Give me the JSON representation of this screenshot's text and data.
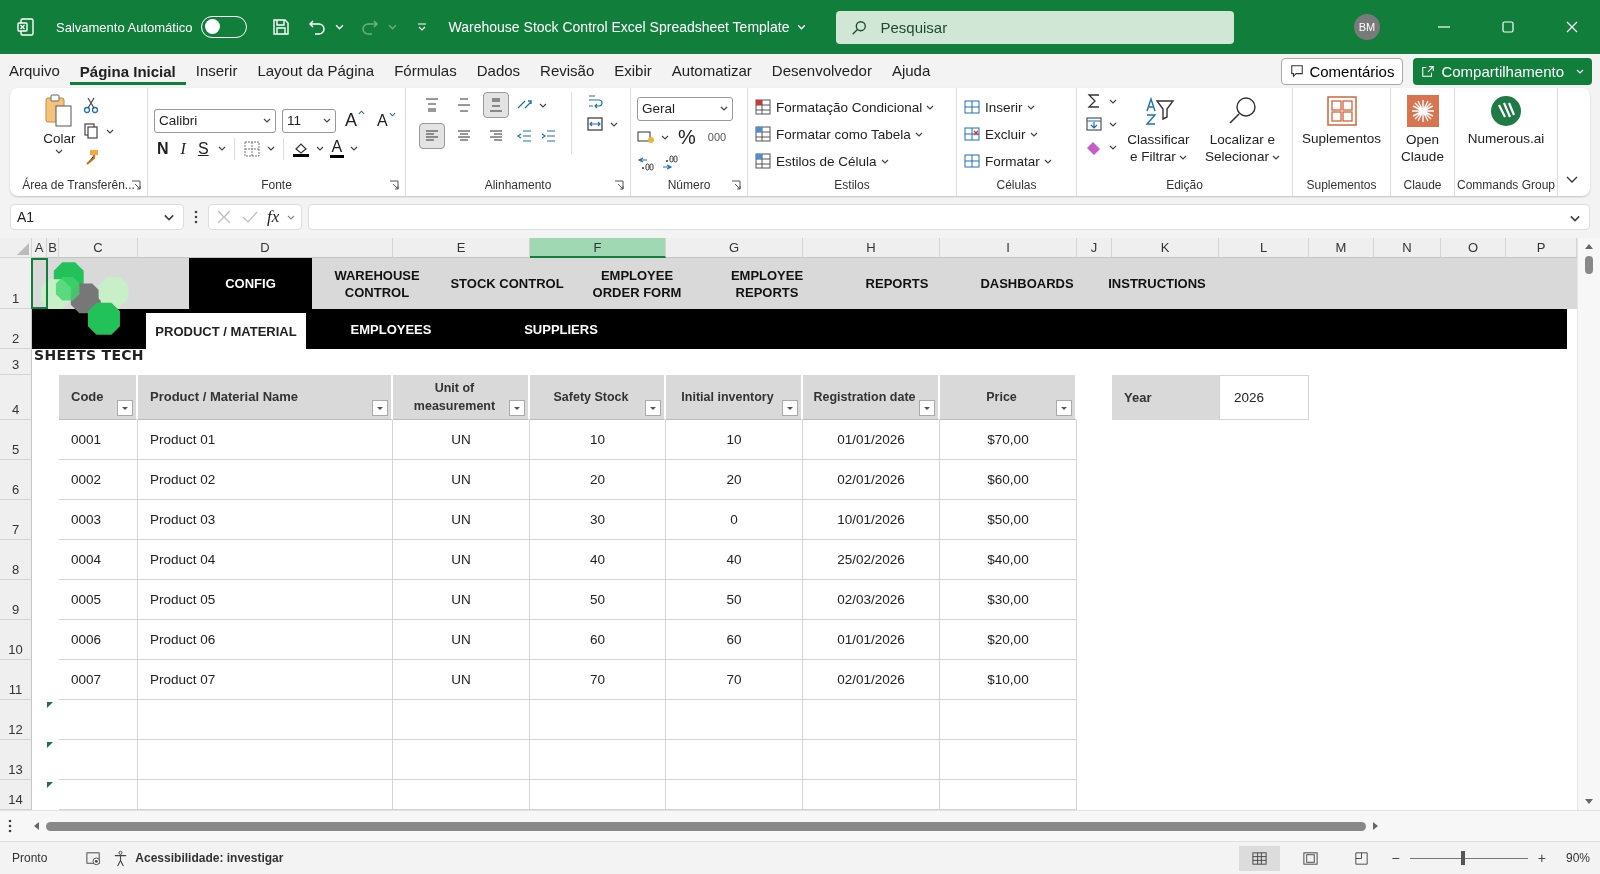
{
  "title_bar": {
    "autosave_label": "Salvamento Automático",
    "autosave_on": false,
    "document_title": "Warehouse Stock Control Excel Spreadsheet Template",
    "search_placeholder": "Pesquisar",
    "user_initials": "BM"
  },
  "menu_tabs": [
    {
      "label": "Arquivo",
      "selected": false
    },
    {
      "label": "Página Inicial",
      "selected": true
    },
    {
      "label": "Inserir",
      "selected": false
    },
    {
      "label": "Layout da Página",
      "selected": false
    },
    {
      "label": "Fórmulas",
      "selected": false
    },
    {
      "label": "Dados",
      "selected": false
    },
    {
      "label": "Revisão",
      "selected": false
    },
    {
      "label": "Exibir",
      "selected": false
    },
    {
      "label": "Automatizar",
      "selected": false
    },
    {
      "label": "Desenvolvedor",
      "selected": false
    },
    {
      "label": "Ajuda",
      "selected": false
    }
  ],
  "comments_button": "Comentários",
  "share_button": "Compartilhamento",
  "ribbon": {
    "clipboard": {
      "label": "Área de Transferên...",
      "paste": "Colar"
    },
    "font": {
      "label": "Fonte",
      "font_name": "Calibri",
      "font_size": "11",
      "grow": "A",
      "shrink": "A",
      "bold": "N",
      "italic": "I",
      "underline": "S",
      "font_color": "A"
    },
    "alignment": {
      "label": "Alinhamento",
      "vertical_buttons": [
        {
          "selected": false
        },
        {
          "selected": false
        },
        {
          "selected": true
        }
      ],
      "horizontal_buttons": [
        {
          "selected": true
        },
        {
          "selected": false
        },
        {
          "selected": false
        }
      ]
    },
    "number": {
      "label": "Número",
      "format": "Geral",
      "percent": "%",
      "thousands": "000"
    },
    "styles": {
      "label": "Estilos",
      "items": [
        "Formatação Condicional",
        "Formatar como Tabela",
        "Estilos de Célula"
      ]
    },
    "cells": {
      "label": "Células",
      "items": [
        "Inserir",
        "Excluir",
        "Formatar"
      ]
    },
    "editing": {
      "label": "Edição",
      "sort": "Classificar e Filtrar",
      "find": "Localizar e Selecionar"
    },
    "addins": {
      "label": "Suplementos",
      "button": "Suplementos"
    },
    "claude": {
      "label": "Claude",
      "button": "Open Claude"
    },
    "commands": {
      "label": "Commands Group",
      "button": "Numerous.ai"
    }
  },
  "formula_bar": {
    "name_box": "A1",
    "fx": "fx"
  },
  "columns": [
    {
      "label": "A",
      "selected": false
    },
    {
      "label": "B",
      "selected": false
    },
    {
      "label": "C",
      "selected": false
    },
    {
      "label": "D",
      "selected": false
    },
    {
      "label": "E",
      "selected": false
    },
    {
      "label": "F",
      "selected": true
    },
    {
      "label": "G",
      "selected": false
    },
    {
      "label": "H",
      "selected": false
    },
    {
      "label": "I",
      "selected": false
    },
    {
      "label": "J",
      "selected": false
    },
    {
      "label": "K",
      "selected": false
    },
    {
      "label": "L",
      "selected": false
    },
    {
      "label": "M",
      "selected": false
    },
    {
      "label": "N",
      "selected": false
    },
    {
      "label": "O",
      "selected": false
    },
    {
      "label": "P",
      "selected": false
    }
  ],
  "row_numbers": [
    "1",
    "2",
    "3",
    "4",
    "5",
    "6",
    "7",
    "8",
    "9",
    "10",
    "11",
    "12",
    "13",
    "14"
  ],
  "sheet": {
    "logo_text": "SHEETS TECH",
    "nav": [
      {
        "label": "CONFIG",
        "selected": true
      },
      {
        "label": "WAREHOUSE CONTROL",
        "selected": false
      },
      {
        "label": "STOCK CONTROL",
        "selected": false
      },
      {
        "label": "EMPLOYEE ORDER FORM",
        "selected": false
      },
      {
        "label": "EMPLOYEE REPORTS",
        "selected": false
      },
      {
        "label": "REPORTS",
        "selected": false
      },
      {
        "label": "DASHBOARDS",
        "selected": false
      },
      {
        "label": "INSTRUCTIONS",
        "selected": false
      }
    ],
    "subnav": [
      {
        "label": "PRODUCT / MATERIAL",
        "selected": true
      },
      {
        "label": "EMPLOYEES",
        "selected": false
      },
      {
        "label": "SUPPLIERS",
        "selected": false
      }
    ],
    "table": {
      "columns": [
        "Code",
        "Product / Material Name",
        "Unit of measurement",
        "Safety Stock",
        "Initial inventory",
        "Registration date",
        "Price"
      ],
      "rows": [
        [
          "0001",
          "Product 01",
          "UN",
          "10",
          "10",
          "01/01/2026",
          "$70,00"
        ],
        [
          "0002",
          "Product 02",
          "UN",
          "20",
          "20",
          "02/01/2026",
          "$60,00"
        ],
        [
          "0003",
          "Product 03",
          "UN",
          "30",
          "0",
          "10/01/2026",
          "$50,00"
        ],
        [
          "0004",
          "Product 04",
          "UN",
          "40",
          "40",
          "25/02/2026",
          "$40,00"
        ],
        [
          "0005",
          "Product 05",
          "UN",
          "50",
          "50",
          "02/03/2026",
          "$30,00"
        ],
        [
          "0006",
          "Product 06",
          "UN",
          "60",
          "60",
          "01/01/2026",
          "$20,00"
        ],
        [
          "0007",
          "Product 07",
          "UN",
          "70",
          "70",
          "02/01/2026",
          "$10,00"
        ]
      ]
    },
    "year_label": "Year",
    "year_value": "2026"
  },
  "status_bar": {
    "ready": "Pronto",
    "accessibility": "Acessibilidade: investigar",
    "zoom": "90%",
    "zoom_minus": "−",
    "zoom_plus": "+",
    "zoom_slider": {
      "level": 0.45
    }
  }
}
